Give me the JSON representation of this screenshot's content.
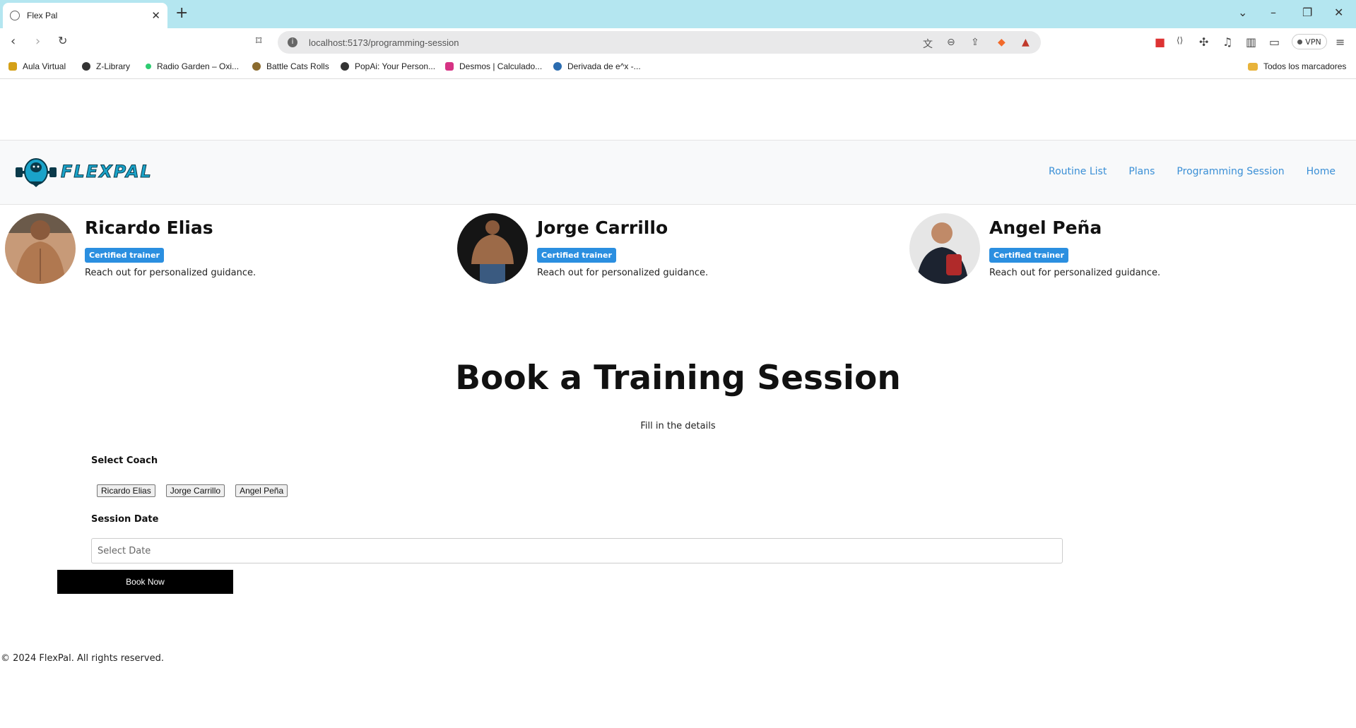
{
  "browser": {
    "tab_title": "Flex Pal",
    "url": "localhost:5173/programming-session",
    "vpn_label": "VPN",
    "bookmarks": [
      {
        "label": "Aula Virtual",
        "color": "#d4a017"
      },
      {
        "label": "Z-Library",
        "color": "#333333"
      },
      {
        "label": "Radio Garden – Oxi...",
        "color": "#2ecc71"
      },
      {
        "label": "Battle Cats Rolls",
        "color": "#8b6b2e"
      },
      {
        "label": "PopAi: Your Person...",
        "color": "#333333"
      },
      {
        "label": "Desmos | Calculado...",
        "color": "#d63384"
      },
      {
        "label": "Derivada de e^x -...",
        "color": "#2b6cb0"
      }
    ],
    "bookmarks_folder": "Todos los marcadores"
  },
  "header": {
    "logo_text": "FLEXPAL",
    "nav": [
      "Routine List",
      "Plans",
      "Programming Session",
      "Home"
    ]
  },
  "trainers": [
    {
      "name": "Ricardo Elias",
      "badge": "Certified trainer",
      "desc": "Reach out for personalized guidance."
    },
    {
      "name": "Jorge Carrillo",
      "badge": "Certified trainer",
      "desc": "Reach out for personalized guidance."
    },
    {
      "name": "Angel Peña",
      "badge": "Certified trainer",
      "desc": "Reach out for personalized guidance."
    }
  ],
  "booking": {
    "title": "Book a Training Session",
    "subtitle": "Fill in the details",
    "coach_label": "Select Coach",
    "coaches": [
      "Ricardo Elias",
      "Jorge Carrillo",
      "Angel Peña"
    ],
    "date_label": "Session Date",
    "date_placeholder": "Select Date",
    "submit_label": "Book Now"
  },
  "footer": {
    "text": "© 2024 FlexPal. All rights reserved."
  },
  "colors": {
    "accent": "#2b8fe0",
    "nav_link": "#3a8fd6",
    "tabbar": "#b4e6f0"
  }
}
